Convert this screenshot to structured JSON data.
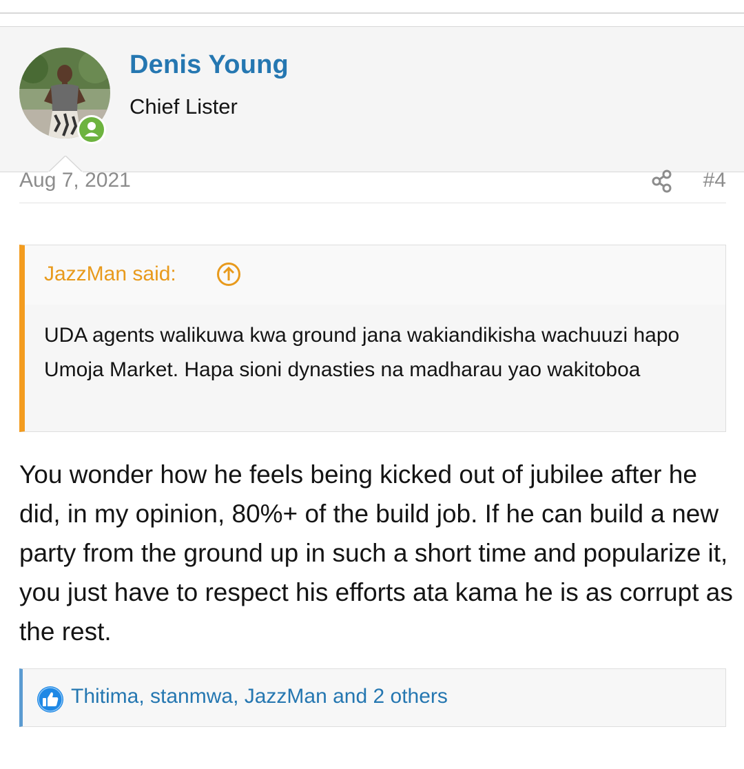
{
  "post": {
    "user": {
      "name": "Denis Young",
      "title": "Chief Lister",
      "status": "online"
    },
    "date": "Aug 7, 2021",
    "number": "#4",
    "quote": {
      "author": "JazzMan said:",
      "text": "UDA agents walikuwa kwa ground jana wakiandikisha wachuuzi hapo Umoja Market. Hapa sioni dynasties na madharau yao wakitoboa"
    },
    "message": "You wonder how he feels being kicked out of jubilee after he did, in my opinion, 80%+ of the build job. If he can build a new party from the ground up in such a short time and popularize it, you just have to respect his efforts ata kama he is as corrupt as the rest.",
    "reactions": {
      "text": "Thitima, stanmwa, JazzMan and 2 others",
      "icon": "like-icon"
    }
  },
  "colors": {
    "link": "#2577b1",
    "quote_accent": "#f39c1f",
    "online": "#6db33f",
    "meta": "#8c8c8c"
  }
}
